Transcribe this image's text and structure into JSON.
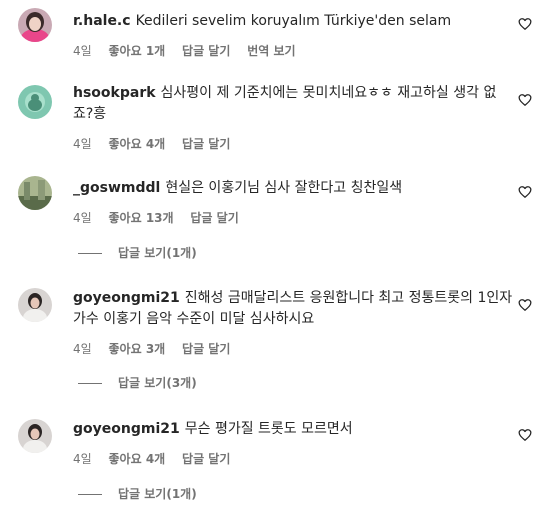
{
  "comments": [
    {
      "username": "r.hale.c",
      "text": "Kedileri sevelim koruyalım Türkiye'den selam",
      "time": "4일",
      "likes": "좋아요 1개",
      "reply_label": "답글 달기",
      "translate_label": "번역 보기"
    },
    {
      "username": "hsookpark",
      "text": "심사평이 제 기준치에는 못미치네요ㅎㅎ 재고하실 생각 없죠?흥",
      "time": "4일",
      "likes": "좋아요 4개",
      "reply_label": "답글 달기"
    },
    {
      "username": "_goswmddl",
      "text": "현실은 이홍기님 심사 잘한다고 칭찬일색",
      "time": "4일",
      "likes": "좋아요 13개",
      "reply_label": "답글 달기",
      "view_replies": "답글 보기(1개)"
    },
    {
      "username": "goyeongmi21",
      "text": "진해성 금매달리스트 응원합니다 최고 정통트롯의 1인자 가수 이홍기 음악 수준이 미달 심사하시요",
      "time": "4일",
      "likes": "좋아요 3개",
      "reply_label": "답글 달기",
      "view_replies": "답글 보기(3개)"
    },
    {
      "username": "goyeongmi21",
      "text": "무슨 평가질 트롯도 모르면서",
      "time": "4일",
      "likes": "좋아요 4개",
      "reply_label": "답글 달기",
      "view_replies": "답글 보기(1개)"
    }
  ],
  "colors": {
    "text": "#262626",
    "secondary": "#737373",
    "background": "#ffffff"
  }
}
